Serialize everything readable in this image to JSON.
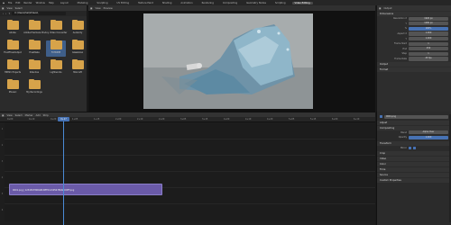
{
  "menubar": {
    "items": [
      "File",
      "Edit",
      "Render",
      "Window",
      "Help"
    ],
    "workspaces": [
      "Layout",
      "Modeling",
      "Sculpting",
      "UV Editing",
      "Texture Paint",
      "Shading",
      "Animation",
      "Rendering",
      "Compositing",
      "Geometry Nodes",
      "Scripting",
      "Video Editing"
    ],
    "active": "Video Editing"
  },
  "file_browser": {
    "path": "C:\\Users\\hel\\Videos\\",
    "header": [
      "View",
      "Select"
    ],
    "folders": [
      "Adobe",
      "Adobe Premiere Pro",
      "Any Video Converter",
      "Audacity",
      "FluidFlowOutput",
      "FreeMake",
      "FXHOME",
      "Glassblow",
      "Hitfilm Projects",
      "Kdenlive",
      "Lightworks",
      "Mixcraft",
      "Movavi",
      "My Recordings"
    ]
  },
  "preview": {
    "header": [
      "View",
      "Preview"
    ]
  },
  "properties": {
    "header": [
      "Output",
      "Properties"
    ],
    "sections": [
      "Dimensions",
      "Output",
      "Format"
    ],
    "fields": [
      {
        "label": "Resolution X",
        "value": "1920 px"
      },
      {
        "label": "Y",
        "value": "1080 px"
      },
      {
        "label": "%",
        "value": "100%"
      },
      {
        "label": "Aspect X",
        "value": "1.000"
      },
      {
        "label": "Y",
        "value": "1.000"
      },
      {
        "label": "Frame Start",
        "value": "1"
      },
      {
        "label": "End",
        "value": "250"
      },
      {
        "label": "Step",
        "value": "1"
      },
      {
        "label": "Frame Rate",
        "value": "25 fps"
      }
    ]
  },
  "sequencer": {
    "header": [
      "View",
      "Select",
      "Marker",
      "Add",
      "Strip"
    ],
    "ticks": [
      "0+00",
      "0+10",
      "0+20",
      "1+05",
      "1+15",
      "2+00",
      "2+10",
      "2+20",
      "3+05",
      "3+15",
      "4+00",
      "4+10",
      "4+20",
      "5+05",
      "5+15",
      "6+00",
      "6+10"
    ],
    "playhead": "0+17",
    "strip_label": "0001.png | 1234567890ABCDEF0123456789ABCDEF.png",
    "channels": [
      "1",
      "2",
      "3",
      "4",
      "5",
      "6"
    ]
  },
  "sidebar": {
    "strip_name": "0001.png",
    "sections": [
      "Adjust",
      "Compositing",
      "Transform",
      "Crop",
      "Video",
      "Color",
      "Time",
      "Source",
      "Custom Properties"
    ],
    "blend": "Alpha Over",
    "opacity": "1.000",
    "mirror": "Mirror",
    "filter": "Filter"
  }
}
